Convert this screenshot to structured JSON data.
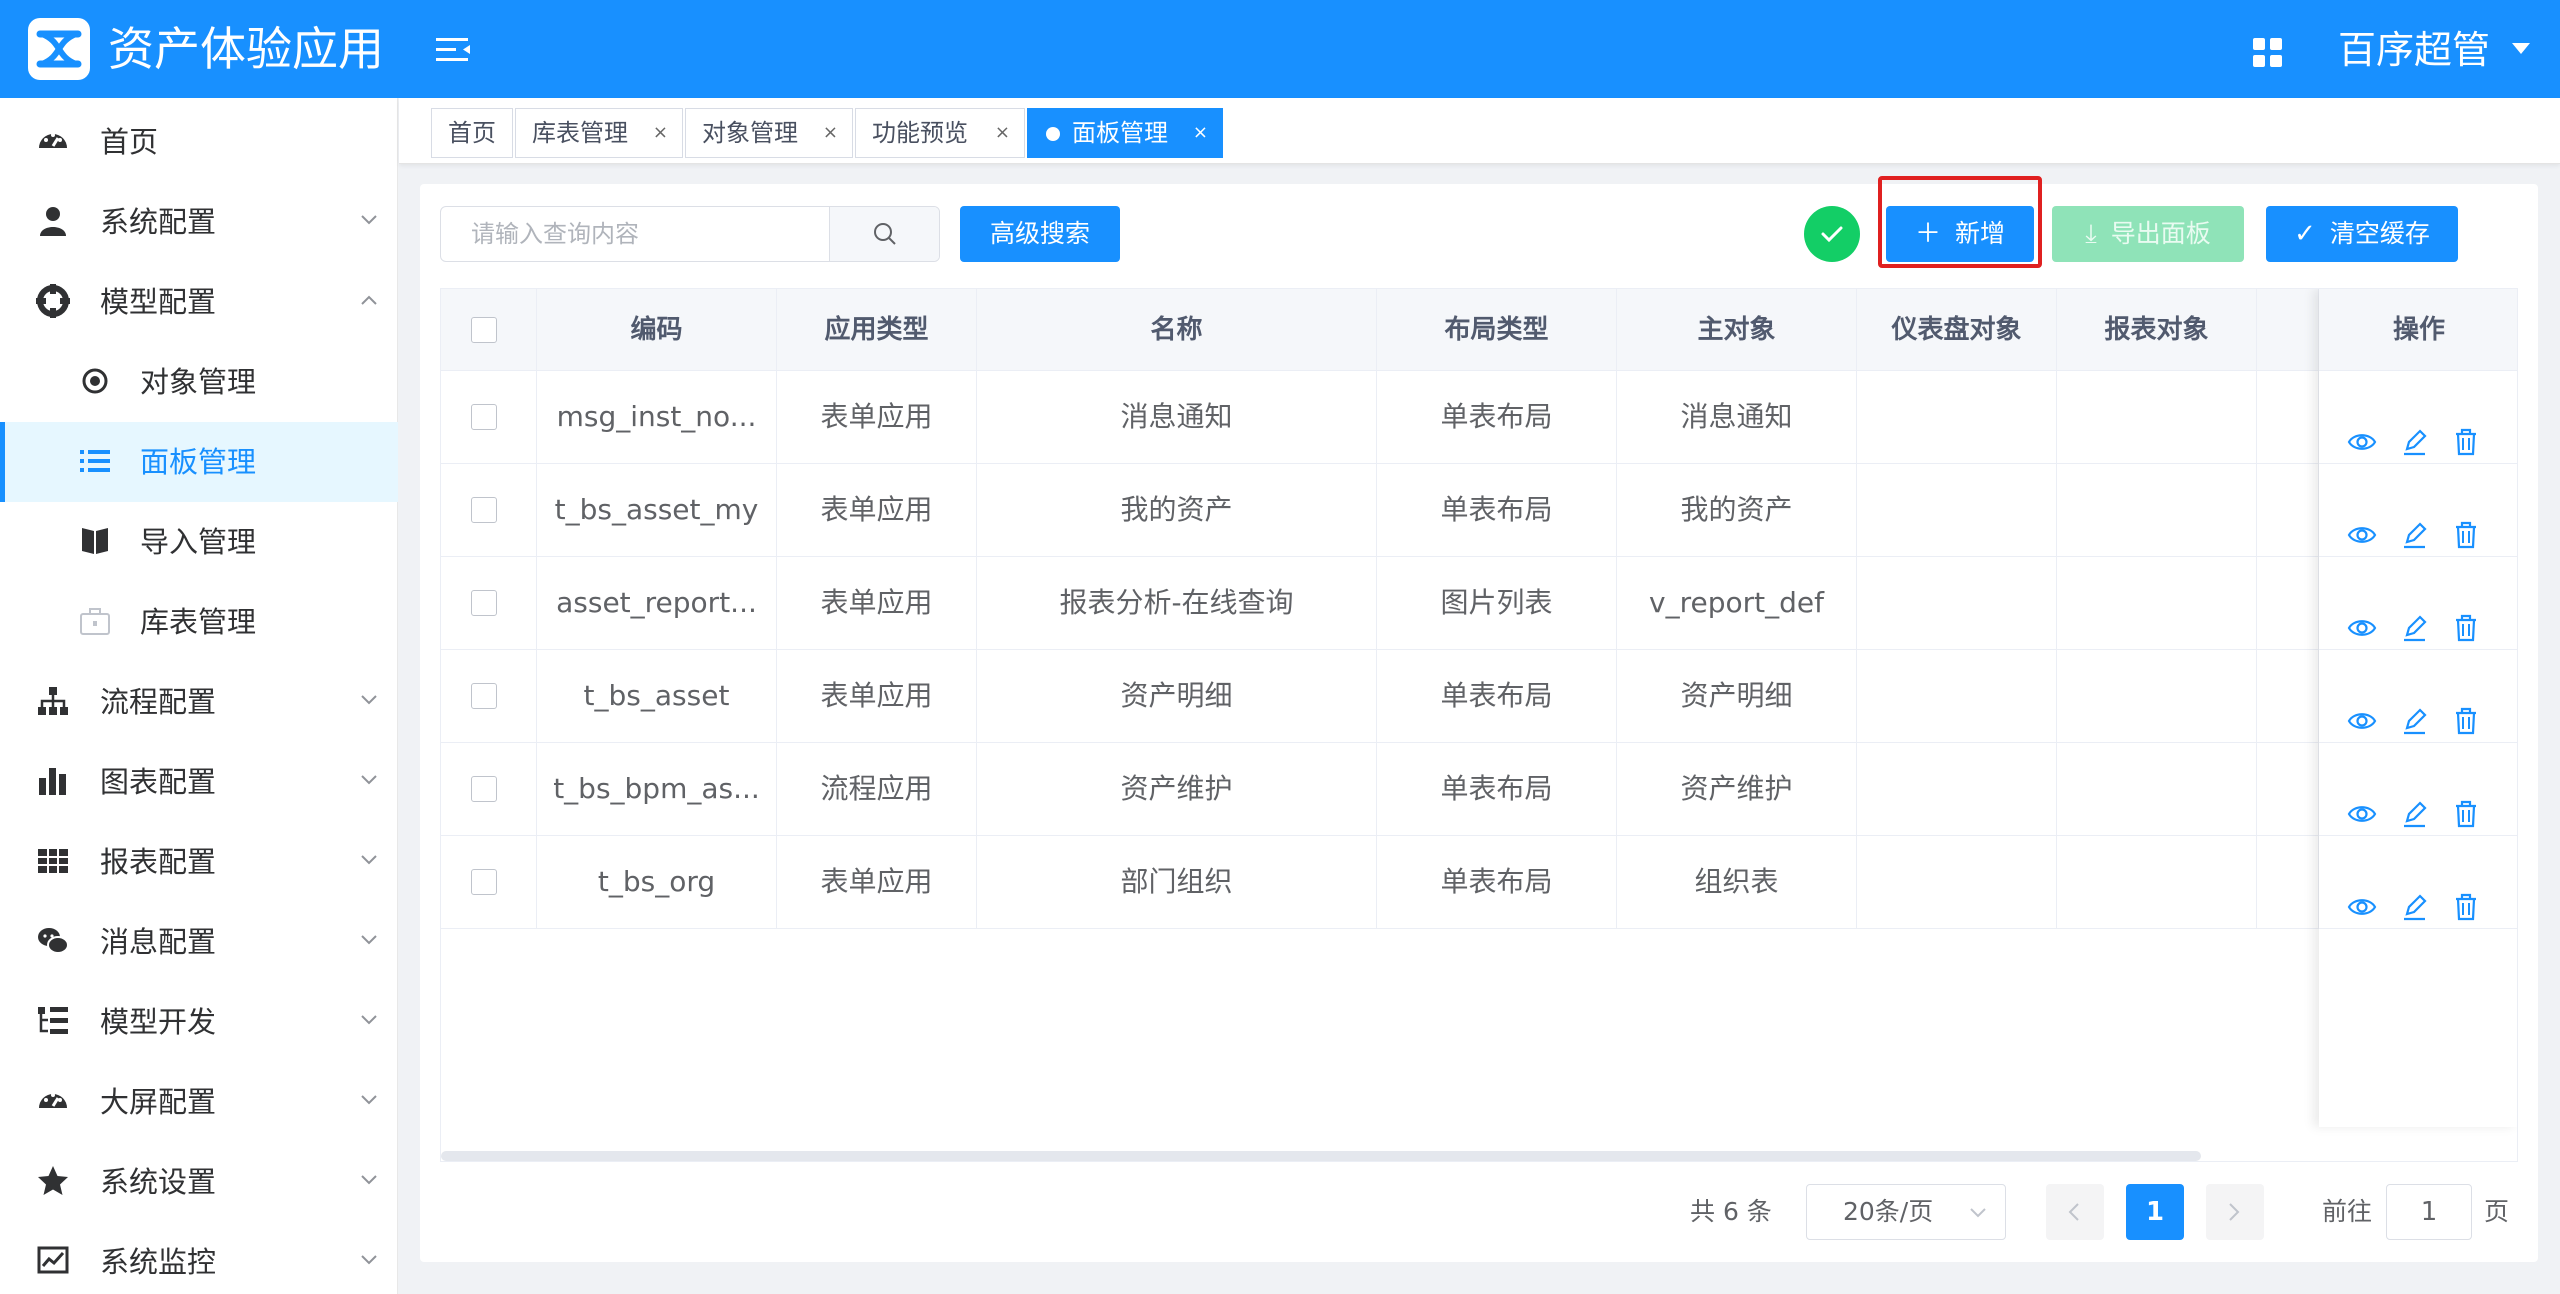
{
  "header": {
    "app_title": "资产体验应用",
    "user_name": "百序超管"
  },
  "sidebar": {
    "items": [
      {
        "label": "首页",
        "icon": "dashboard-icon"
      },
      {
        "label": "系统配置",
        "icon": "user-icon"
      },
      {
        "label": "模型配置",
        "icon": "target-icon",
        "expanded": true
      },
      {
        "label": "对象管理",
        "icon": "radio-dot-icon"
      },
      {
        "label": "面板管理",
        "icon": "list-icon",
        "active": true
      },
      {
        "label": "导入管理",
        "icon": "book-icon"
      },
      {
        "label": "库表管理",
        "icon": "briefcase-icon"
      },
      {
        "label": "流程配置",
        "icon": "hierarchy-icon"
      },
      {
        "label": "图表配置",
        "icon": "bar-chart-icon"
      },
      {
        "label": "报表配置",
        "icon": "table-icon"
      },
      {
        "label": "消息配置",
        "icon": "chat-icon"
      },
      {
        "label": "模型开发",
        "icon": "tree-list-icon"
      },
      {
        "label": "大屏配置",
        "icon": "gauge-icon"
      },
      {
        "label": "系统设置",
        "icon": "star-icon"
      },
      {
        "label": "系统监控",
        "icon": "monitor-chart-icon"
      }
    ]
  },
  "tabs": [
    {
      "label": "首页"
    },
    {
      "label": "库表管理"
    },
    {
      "label": "对象管理"
    },
    {
      "label": "功能预览"
    },
    {
      "label": "面板管理",
      "active": true
    }
  ],
  "toolbar": {
    "search_placeholder": "请输入查询内容",
    "advanced_search": "高级搜索",
    "add": "新增",
    "export": "导出面板",
    "clear_cache": "清空缓存"
  },
  "table": {
    "columns": [
      "编码",
      "应用类型",
      "名称",
      "布局类型",
      "主对象",
      "仪表盘对象",
      "报表对象",
      "操作"
    ],
    "rows": [
      [
        "msg_inst_no...",
        "表单应用",
        "消息通知",
        "单表布局",
        "消息通知",
        "",
        ""
      ],
      [
        "t_bs_asset_my",
        "表单应用",
        "我的资产",
        "单表布局",
        "我的资产",
        "",
        ""
      ],
      [
        "asset_report...",
        "表单应用",
        "报表分析-在线查询",
        "图片列表",
        "v_report_def",
        "",
        ""
      ],
      [
        "t_bs_asset",
        "表单应用",
        "资产明细",
        "单表布局",
        "资产明细",
        "",
        ""
      ],
      [
        "t_bs_bpm_as...",
        "流程应用",
        "资产维护",
        "单表布局",
        "资产维护",
        "",
        ""
      ],
      [
        "t_bs_org",
        "表单应用",
        "部门组织",
        "单表布局",
        "组织表",
        "",
        ""
      ]
    ]
  },
  "pagination": {
    "total_text": "共 6 条",
    "page_size": "20条/页",
    "current_page": "1",
    "goto_label": "前往",
    "goto_value": "1",
    "page_suffix": "页"
  },
  "colors": {
    "primary": "#1890ff",
    "success": "#13ce66",
    "highlight": "#e02020"
  }
}
